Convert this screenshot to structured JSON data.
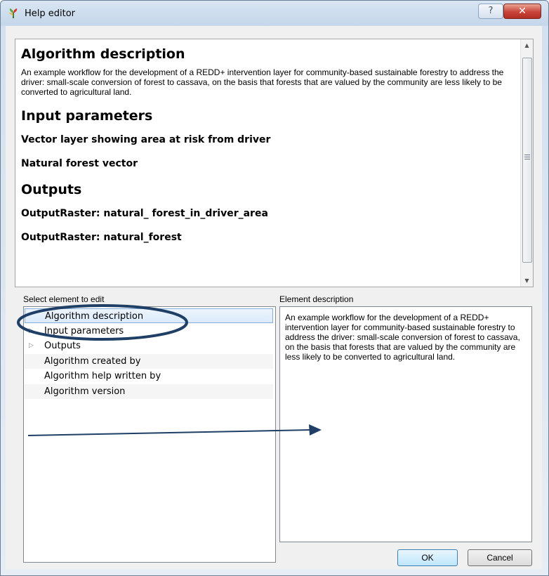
{
  "window": {
    "title": "Help editor",
    "help_label": "?",
    "close_label": "✕",
    "app_icon": "app-logo-icon"
  },
  "help_view": {
    "heading_algorithm": "Algorithm description",
    "description": "An example workflow for the development of a REDD+ intervention layer for community-based sustainable forestry to address the driver: small-scale conversion of forest to cassava, on the basis that forests that are valued by the community are less likely to be converted to agricultural land.",
    "heading_inputs": "Input parameters",
    "inputs": [
      "Vector layer showing area at risk from driver",
      "Natural forest vector"
    ],
    "heading_outputs": "Outputs",
    "outputs": [
      "OutputRaster: natural_ forest_in_driver_area",
      "OutputRaster: natural_forest"
    ],
    "scroll_up": "▲",
    "scroll_down": "▼"
  },
  "element_tree": {
    "label": "Select element to edit",
    "items": [
      "Algorithm description",
      "Input parameters",
      "Outputs",
      "Algorithm created by",
      "Algorithm help written by",
      "Algorithm version"
    ],
    "selected": "Algorithm description"
  },
  "element_description": {
    "label": "Element description",
    "text": "An example workflow for the development of a REDD+ intervention layer for community-based sustainable forestry to address the driver: small-scale conversion of forest to cassava, on the basis that forests that are valued by the community are less likely to be converted to agricultural land."
  },
  "buttons": {
    "ok": "OK",
    "cancel": "Cancel"
  },
  "annotation_color": "#1f3f66"
}
